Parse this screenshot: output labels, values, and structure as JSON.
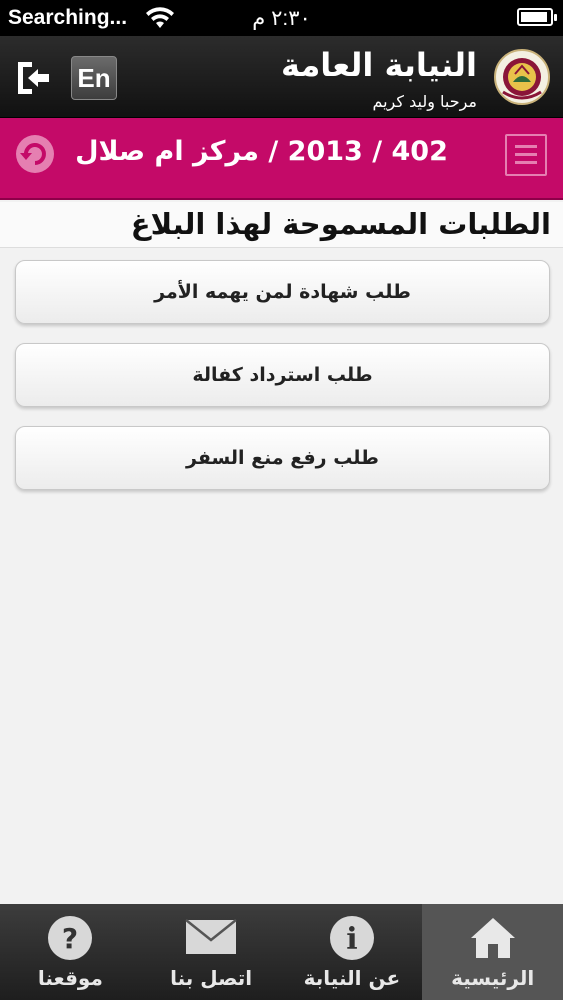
{
  "status_bar": {
    "carrier": "Searching...",
    "time": "٢:٣٠ م"
  },
  "header": {
    "title": "النيابة العامة",
    "welcome": "مرحبا وليد كريم",
    "lang_label": "En"
  },
  "case_bar": {
    "title": "402 / 2013 / مركز ام صلال"
  },
  "section": {
    "title": "الطلبات المسموحة لهذا البلاغ"
  },
  "requests": [
    {
      "label": "طلب شهادة لمن يهمه الأمر"
    },
    {
      "label": "طلب استرداد كفالة"
    },
    {
      "label": "طلب رفع منع السفر"
    }
  ],
  "tabs": [
    {
      "label": "موقعنا",
      "icon": "help-icon"
    },
    {
      "label": "اتصل بنا",
      "icon": "mail-icon"
    },
    {
      "label": "عن النيابة",
      "icon": "info-icon"
    },
    {
      "label": "الرئيسية",
      "icon": "home-icon"
    }
  ],
  "colors": {
    "accent": "#c40a68",
    "header_bg": "#1a1a1a",
    "tab_bg": "#2a2a2a"
  }
}
